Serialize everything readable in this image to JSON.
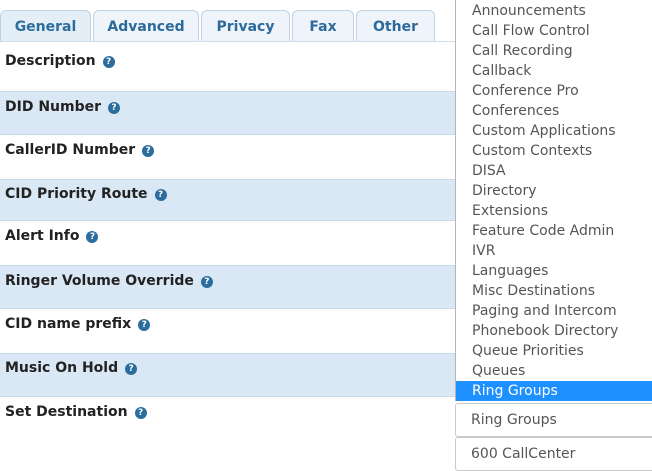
{
  "tabs": [
    "General",
    "Advanced",
    "Privacy",
    "Fax",
    "Other"
  ],
  "form": {
    "rows": [
      {
        "label": "Description"
      },
      {
        "label": "DID Number"
      },
      {
        "label": "CallerID Number"
      },
      {
        "label": "CID Priority Route"
      },
      {
        "label": "Alert Info"
      },
      {
        "label": "Ringer Volume Override"
      },
      {
        "label": "CID name prefix"
      },
      {
        "label": "Music On Hold"
      },
      {
        "label": "Set Destination"
      }
    ],
    "help_glyph": "?"
  },
  "dropdown": {
    "options": [
      "Announcements",
      "Call Flow Control",
      "Call Recording",
      "Callback",
      "Conference Pro",
      "Conferences",
      "Custom Applications",
      "Custom Contexts",
      "DISA",
      "Directory",
      "Extensions",
      "Feature Code Admin",
      "IVR",
      "Languages",
      "Misc Destinations",
      "Paging and Intercom",
      "Phonebook Directory",
      "Queue Priorities",
      "Queues",
      "Ring Groups"
    ],
    "selected": "Ring Groups",
    "highlight_color": "#1e90ff"
  },
  "destination": {
    "category_value": "Ring Groups",
    "target_value": "600 CallCenter"
  },
  "colors": {
    "tab_text": "#2c6a9a",
    "row_shade": "#d9e8f4",
    "help_icon": "#2b6d9d"
  }
}
